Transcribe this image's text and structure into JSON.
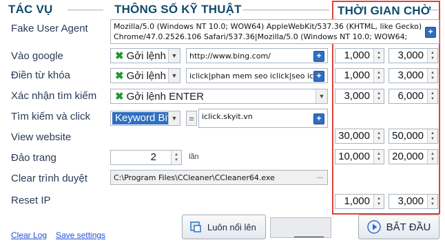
{
  "headers": {
    "tasks": "TÁC VỤ",
    "specs": "THÔNG SỐ KỸ THUẬT",
    "wait": "THỜI GIAN CHỜ"
  },
  "labels": {
    "fake_user_agent": "Fake User Agent",
    "goto_google": "Vào google",
    "fill_keyword": "Điền từ khóa",
    "confirm_search": "Xác nhận tìm kiếm",
    "search_click": "Tìm kiếm và click",
    "view_website": "View website",
    "page_flip": "Đảo trang",
    "clear_browser": "Clear trình duyệt",
    "reset_ip": "Reset IP"
  },
  "user_agent_text": "Mozilla/5.0 (Windows NT 10.0; WOW64) AppleWebKit/537.36 (KHTML, like Gecko) Chrome/47.0.2526.106 Safari/537.36|Mozilla/5.0 (Windows NT 10.0; WOW64;",
  "rows": {
    "google": {
      "command": "Gởi lệnh",
      "url": "http://www.bing.com/"
    },
    "keyword": {
      "command": "Gởi lệnh",
      "value": "iclick|phan mem seo iclick|seo icli"
    },
    "confirm": {
      "command": "Gởi lệnh ENTER"
    },
    "search": {
      "mode": "Keyword Bit",
      "op": "=",
      "value": "iclick.skyit.vn"
    },
    "page_flip": {
      "count": "2",
      "unit": "lần"
    },
    "clear": {
      "path": "C:\\Program Files\\CCleaner\\CCleaner64.exe",
      "browse": "..."
    }
  },
  "waits": [
    {
      "min": "1,000",
      "max": "3,000"
    },
    {
      "min": "1,000",
      "max": "3,000"
    },
    {
      "min": "3,000",
      "max": "6,000"
    },
    {
      "min": "30,000",
      "max": "50,000"
    },
    {
      "min": "10,000",
      "max": "20,000"
    },
    {
      "min": "1,000",
      "max": "3,000"
    }
  ],
  "footer": {
    "clear_log": "Clear Log",
    "save_settings": "Save settings",
    "always_on_top": "Luôn nổi lên",
    "start": "BẮT ĐẦU"
  },
  "colors": {
    "highlight": "#e0403a",
    "accent": "#2f6fbf",
    "green": "#1e9a2d"
  }
}
